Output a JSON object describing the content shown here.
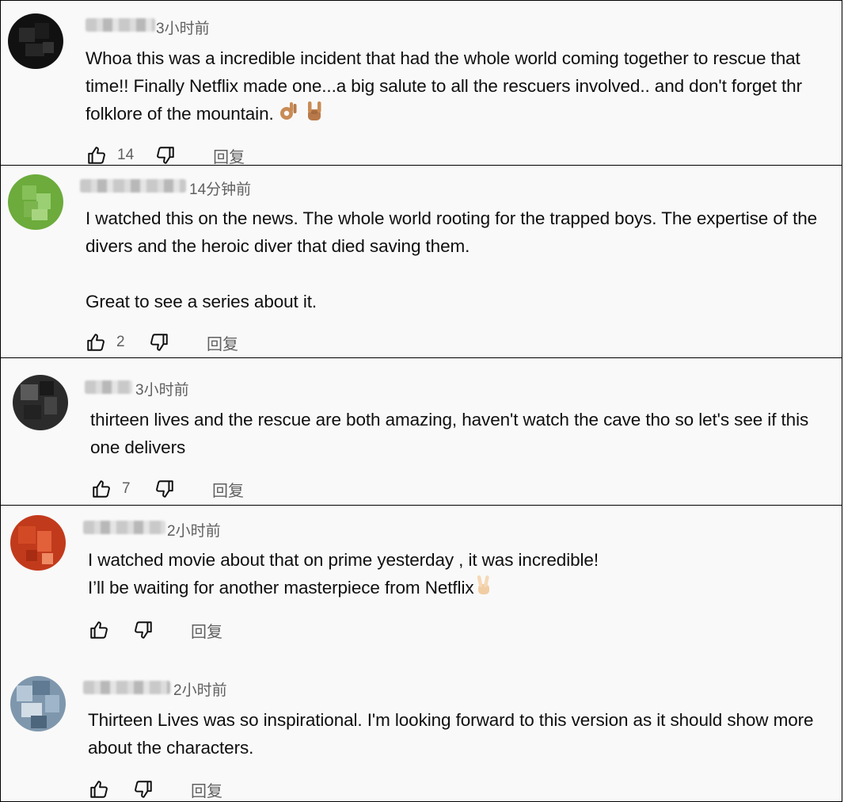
{
  "comments": [
    {
      "time": "3小时前",
      "text": "Whoa this was a incredible incident that had the whole world coming together to rescue that time!! Finally Netflix made one...a big salute to all the rescuers involved.. and don't forget thr folklore of the mountain.",
      "likes": "14",
      "reply": "回复"
    },
    {
      "time": "14分钟前",
      "text": "I watched this on the news. The whole world rooting for the trapped boys. The expertise of the divers and the heroic diver that died saving them.\n\nGreat to see a series about it.",
      "likes": "2",
      "reply": "回复"
    },
    {
      "time": "3小时前",
      "text": "thirteen lives and the rescue are both amazing, haven't watch the cave tho so let's see if this one delivers",
      "likes": "7",
      "reply": "回复"
    },
    {
      "time": "2小时前",
      "text": "I watched movie about that on prime yesterday , it was incredible!\nI’ll be waiting for another masterpiece from Netflix",
      "likes": "",
      "reply": "回复"
    },
    {
      "time": "2小时前",
      "text": "Thirteen Lives was so inspirational. I'm looking forward to this version as it should show more about the characters.",
      "likes": "",
      "reply": "回复"
    }
  ],
  "icons": {
    "like": "thumbs-up-icon",
    "dislike": "thumbs-down-icon",
    "ok_hand": "ok-hand-emoji",
    "horns": "sign-of-horns-emoji",
    "victory": "victory-hand-emoji"
  },
  "colors": {
    "text": "#0f0f0f",
    "secondary": "#606060",
    "background": "#f9f9f9",
    "border": "#000000"
  }
}
